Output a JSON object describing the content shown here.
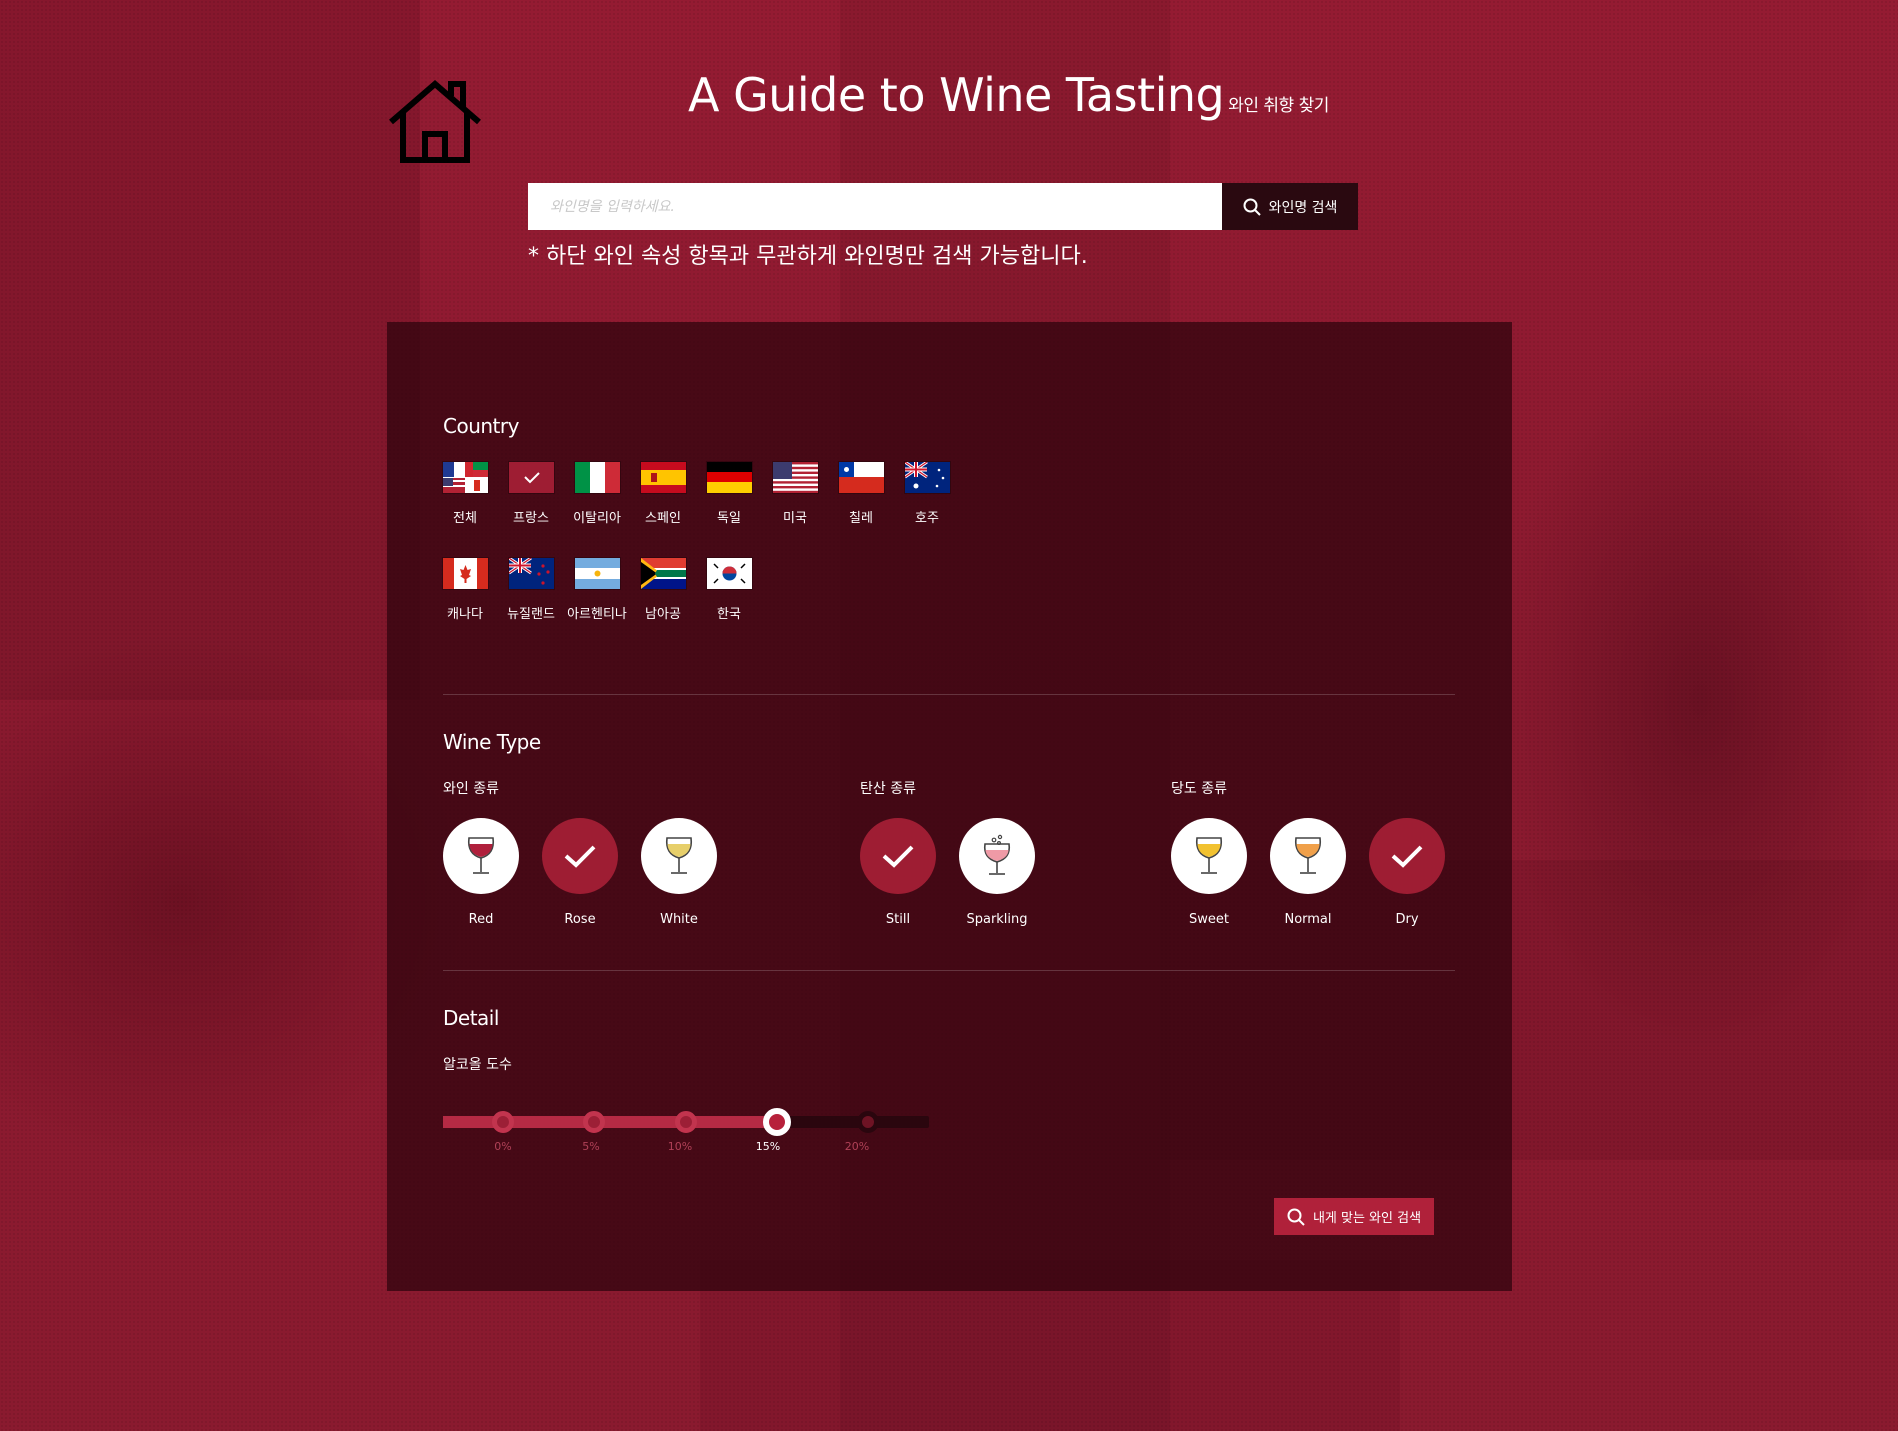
{
  "header": {
    "title": "A Guide to Wine Tasting",
    "subtitle": "와인 취향 찾기"
  },
  "search": {
    "placeholder": "와인명을 입력하세요.",
    "button_label": "와인명 검색",
    "note": "* 하단 와인 속성 항목과 무관하게 와인명만 검색 가능합니다."
  },
  "country": {
    "title": "Country",
    "items": [
      {
        "label": "전체",
        "flag": "all",
        "selected": false
      },
      {
        "label": "프랑스",
        "flag": "france",
        "selected": true
      },
      {
        "label": "이탈리아",
        "flag": "italy",
        "selected": false
      },
      {
        "label": "스페인",
        "flag": "spain",
        "selected": false
      },
      {
        "label": "독일",
        "flag": "germany",
        "selected": false
      },
      {
        "label": "미국",
        "flag": "usa",
        "selected": false
      },
      {
        "label": "칠레",
        "flag": "chile",
        "selected": false
      },
      {
        "label": "호주",
        "flag": "australia",
        "selected": false
      },
      {
        "label": "캐나다",
        "flag": "canada",
        "selected": false
      },
      {
        "label": "뉴질랜드",
        "flag": "newzealand",
        "selected": false
      },
      {
        "label": "아르헨티나",
        "flag": "argentina",
        "selected": false
      },
      {
        "label": "남아공",
        "flag": "southafrica",
        "selected": false
      },
      {
        "label": "한국",
        "flag": "korea",
        "selected": false
      }
    ]
  },
  "wine_type": {
    "title": "Wine Type",
    "groups": [
      {
        "label": "와인 종류",
        "options": [
          {
            "label": "Red",
            "icon": "red-wine-glass-icon",
            "selected": false
          },
          {
            "label": "Rose",
            "icon": "rose-wine-glass-icon",
            "selected": true
          },
          {
            "label": "White",
            "icon": "white-wine-glass-icon",
            "selected": false
          }
        ]
      },
      {
        "label": "탄산 종류",
        "options": [
          {
            "label": "Still",
            "icon": "still-wine-glass-icon",
            "selected": true
          },
          {
            "label": "Sparkling",
            "icon": "sparkling-wine-glass-icon",
            "selected": false
          }
        ]
      },
      {
        "label": "당도 종류",
        "options": [
          {
            "label": "Sweet",
            "icon": "sweet-wine-glass-icon",
            "selected": false
          },
          {
            "label": "Normal",
            "icon": "normal-wine-glass-icon",
            "selected": false
          },
          {
            "label": "Dry",
            "icon": "dry-wine-glass-icon",
            "selected": true
          }
        ]
      }
    ]
  },
  "detail": {
    "title": "Detail",
    "alcohol_label": "알코올 도수",
    "ticks": [
      "0%",
      "5%",
      "10%",
      "15%",
      "20%"
    ],
    "selected_index": 3
  },
  "my_search_button": "내게 맞는 와인 검색",
  "colors": {
    "background": "#8f1d33",
    "panel": "#2d030d",
    "accent": "#9e1d33",
    "search_button": "#2a0910"
  }
}
